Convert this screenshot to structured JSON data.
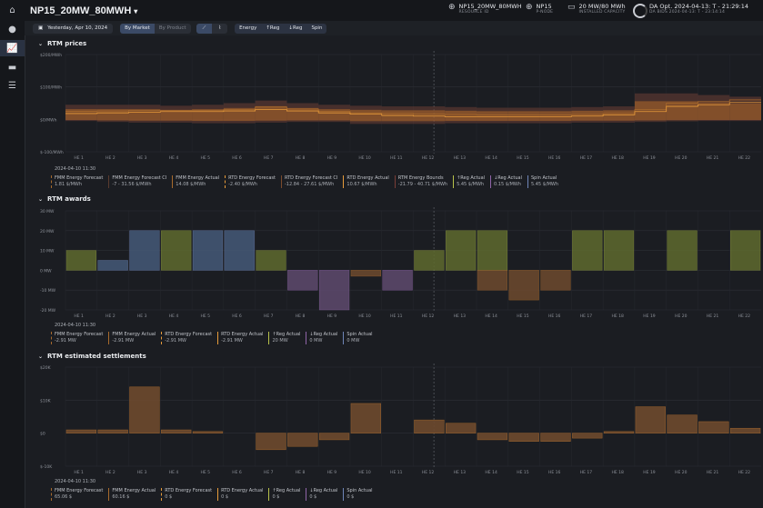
{
  "nav": {
    "icons": [
      "home-icon",
      "dollar-icon",
      "chart-icon",
      "toggle-icon",
      "list-icon"
    ]
  },
  "header": {
    "title": "NP15_20MW_80MWH",
    "resource_id": {
      "value": "NP15_20MW_80MWH",
      "label": "RESOURCE ID"
    },
    "pnode": {
      "value": "NP15",
      "label": "P-NODE"
    },
    "capacity": {
      "value": "20 MW/80 MWh",
      "label": "INSTALLED CAPACITY"
    },
    "da_opt": "DA Opt. 2024-04-13: T - 21:29:14",
    "da_bids": "DA BIDS 2024-04-13: T - 23:14:14"
  },
  "toolbar": {
    "date": "Yesterday, Apr 10, 2024",
    "by_market": "By Market",
    "by_product": "By Product",
    "products": [
      "Energy",
      "↑Reg",
      "↓Reg",
      "Spin"
    ]
  },
  "hours": [
    "HE 1",
    "HE 2",
    "HE 3",
    "HE 4",
    "HE 5",
    "HE 6",
    "HE 7",
    "HE 8",
    "HE 9",
    "HE 10",
    "HE 11",
    "HE 12",
    "HE 13",
    "HE 14",
    "HE 15",
    "HE 16",
    "HE 17",
    "HE 18",
    "HE 19",
    "HE 20",
    "HE 21",
    "HE 22"
  ],
  "colors": {
    "fmm": "#a86a2c",
    "fmm_ci": "#5a3b2e",
    "rtd": "#e79b3a",
    "bounds": "#7a3d36",
    "up": "#b8c24a",
    "down": "#8f64a8",
    "spin": "#6f86b8",
    "award_up": "#5e6a2e",
    "award_spin": "#455a78",
    "award_down": "#5e4a6e"
  },
  "prices": {
    "title": "RTM prices",
    "yticks": [
      "$200/MWh",
      "$100/MWh",
      "$0/MWh",
      "$-100/MWh"
    ],
    "timestamp": "2024-04-10 11:30",
    "legend": [
      {
        "name": "FMM Energy Forecast",
        "value": "1.81 $/MWh",
        "color": "#a86a2c",
        "dashed": true
      },
      {
        "name": "FMM Energy Forecast CI",
        "value": "-7 - 31.56 $/MWh",
        "color": "#5a3b2e",
        "dashed": false
      },
      {
        "name": "FMM Energy Actual",
        "value": "14.08 $/MWh",
        "color": "#a86a2c",
        "dashed": false
      },
      {
        "name": "RTD Energy Forecast",
        "value": "-2.40 $/MWh",
        "color": "#e79b3a",
        "dashed": true
      },
      {
        "name": "RTD Energy Forecast CI",
        "value": "-12.84 - 27.61 $/MWh",
        "color": "#7a4a2c",
        "dashed": false
      },
      {
        "name": "RTD Energy Actual",
        "value": "10.67 $/MWh",
        "color": "#e79b3a",
        "dashed": false
      },
      {
        "name": "RTM Energy Bounds",
        "value": "-21.79 - 40.71 $/MWh",
        "color": "#7a3d36",
        "dashed": false
      },
      {
        "name": "↑Reg Actual",
        "value": "5.45 $/MWh",
        "color": "#b8c24a",
        "dashed": false
      },
      {
        "name": "↓Reg Actual",
        "value": "0.15 $/MWh",
        "color": "#8f64a8",
        "dashed": false
      },
      {
        "name": "Spin Actual",
        "value": "5.45 $/MWh",
        "color": "#6f86b8",
        "dashed": false
      }
    ]
  },
  "awards": {
    "title": "RTM awards",
    "yticks": [
      "30 MW",
      "20 MW",
      "10 MW",
      "0 MW",
      "-10 MW",
      "-20 MW"
    ],
    "timestamp": "2024-04-10 11:30",
    "legend": [
      {
        "name": "FMM Energy Forecast",
        "value": "-2.91 MW",
        "color": "#a86a2c",
        "dashed": true
      },
      {
        "name": "FMM Energy Actual",
        "value": "-2.91 MW",
        "color": "#a86a2c",
        "dashed": false
      },
      {
        "name": "RTD Energy Forecast",
        "value": "-2.91 MW",
        "color": "#e79b3a",
        "dashed": true
      },
      {
        "name": "RTD Energy Actual",
        "value": "-2.91 MW",
        "color": "#e79b3a",
        "dashed": false
      },
      {
        "name": "↑Reg Actual",
        "value": "20 MW",
        "color": "#b8c24a",
        "dashed": false
      },
      {
        "name": "↓Reg Actual",
        "value": "0 MW",
        "color": "#8f64a8",
        "dashed": false
      },
      {
        "name": "Spin Actual",
        "value": "0 MW",
        "color": "#6f86b8",
        "dashed": false
      }
    ]
  },
  "settlements": {
    "title": "RTM estimated settlements",
    "yticks": [
      "$20K",
      "$10K",
      "$0",
      "$-10K"
    ],
    "timestamp": "2024-04-10 11:30",
    "legend": [
      {
        "name": "FMM Energy Forecast",
        "value": "65.06 $",
        "color": "#a86a2c",
        "dashed": true
      },
      {
        "name": "FMM Energy Actual",
        "value": "60.16 $",
        "color": "#a86a2c",
        "dashed": false
      },
      {
        "name": "RTD Energy Forecast",
        "value": "0 $",
        "color": "#e79b3a",
        "dashed": true
      },
      {
        "name": "RTD Energy Actual",
        "value": "0 $",
        "color": "#e79b3a",
        "dashed": false
      },
      {
        "name": "↑Reg Actual",
        "value": "0 $",
        "color": "#b8c24a",
        "dashed": false
      },
      {
        "name": "↓Reg Actual",
        "value": "0 $",
        "color": "#8f64a8",
        "dashed": false
      },
      {
        "name": "Spin Actual",
        "value": "0 $",
        "color": "#6f86b8",
        "dashed": false
      }
    ]
  },
  "chart_data": [
    {
      "type": "area",
      "title": "RTM prices",
      "ylim": [
        -100,
        200
      ],
      "categories": [
        "HE 1",
        "HE 2",
        "HE 3",
        "HE 4",
        "HE 5",
        "HE 6",
        "HE 7",
        "HE 8",
        "HE 9",
        "HE 10",
        "HE 11",
        "HE 12",
        "HE 13",
        "HE 14",
        "HE 15",
        "HE 16",
        "HE 17",
        "HE 18",
        "HE 19",
        "HE 20",
        "HE 21",
        "HE 22"
      ],
      "series": [
        {
          "name": "RTM Energy Bounds",
          "low": [
            -5,
            -8,
            -10,
            -10,
            -12,
            -12,
            -10,
            -8,
            -8,
            -14,
            -14,
            -14,
            -12,
            -12,
            -12,
            -12,
            -10,
            -10,
            -8,
            -6,
            -5,
            -5
          ],
          "high": [
            45,
            45,
            45,
            42,
            45,
            50,
            58,
            50,
            45,
            42,
            40,
            40,
            38,
            36,
            36,
            36,
            38,
            40,
            80,
            80,
            75,
            70
          ]
        },
        {
          "name": "FMM Energy Actual",
          "values": [
            25,
            26,
            28,
            28,
            28,
            30,
            38,
            32,
            25,
            20,
            18,
            16,
            15,
            14,
            14,
            14,
            15,
            18,
            30,
            50,
            55,
            60
          ]
        },
        {
          "name": "RTD Energy Actual",
          "values": [
            18,
            20,
            22,
            24,
            24,
            26,
            30,
            26,
            20,
            16,
            12,
            10,
            8,
            8,
            8,
            8,
            10,
            14,
            24,
            40,
            45,
            52
          ]
        }
      ]
    },
    {
      "type": "bar",
      "title": "RTM awards",
      "ylim": [
        -20,
        30
      ],
      "categories": [
        "HE 1",
        "HE 2",
        "HE 3",
        "HE 4",
        "HE 5",
        "HE 6",
        "HE 7",
        "HE 8",
        "HE 9",
        "HE 10",
        "HE 11",
        "HE 12",
        "HE 13",
        "HE 14",
        "HE 15",
        "HE 16",
        "HE 17",
        "HE 18",
        "HE 19",
        "HE 20",
        "HE 21",
        "HE 22"
      ],
      "series": [
        {
          "name": "↑Reg Actual",
          "values": [
            10,
            0,
            0,
            20,
            0,
            0,
            10,
            0,
            0,
            0,
            0,
            10,
            20,
            20,
            0,
            0,
            20,
            20,
            0,
            20,
            0,
            20
          ]
        },
        {
          "name": "Spin Actual",
          "values": [
            0,
            5,
            20,
            0,
            20,
            20,
            0,
            0,
            0,
            0,
            0,
            0,
            0,
            0,
            0,
            0,
            0,
            0,
            0,
            0,
            0,
            0
          ]
        },
        {
          "name": "↓Reg Actual",
          "values": [
            0,
            0,
            0,
            0,
            0,
            0,
            0,
            -10,
            -20,
            0,
            -10,
            0,
            0,
            0,
            0,
            0,
            0,
            0,
            0,
            0,
            0,
            0
          ]
        },
        {
          "name": "FMM Energy Actual",
          "values": [
            0,
            0,
            0,
            0,
            0,
            0,
            0,
            0,
            0,
            -3,
            0,
            0,
            0,
            -10,
            -15,
            -10,
            0,
            0,
            0,
            0,
            0,
            0
          ]
        }
      ]
    },
    {
      "type": "bar",
      "title": "RTM estimated settlements",
      "ylim": [
        -10000,
        20000
      ],
      "categories": [
        "HE 1",
        "HE 2",
        "HE 3",
        "HE 4",
        "HE 5",
        "HE 6",
        "HE 7",
        "HE 8",
        "HE 9",
        "HE 10",
        "HE 11",
        "HE 12",
        "HE 13",
        "HE 14",
        "HE 15",
        "HE 16",
        "HE 17",
        "HE 18",
        "HE 19",
        "HE 20",
        "HE 21",
        "HE 22"
      ],
      "series": [
        {
          "name": "FMM Energy Actual",
          "values": [
            1000,
            1000,
            14000,
            1000,
            500,
            0,
            -5000,
            -4000,
            -2000,
            9000,
            0,
            4000,
            3000,
            -2000,
            -2500,
            -2500,
            -1500,
            500,
            8000,
            5500,
            3500,
            1500
          ]
        }
      ]
    }
  ]
}
